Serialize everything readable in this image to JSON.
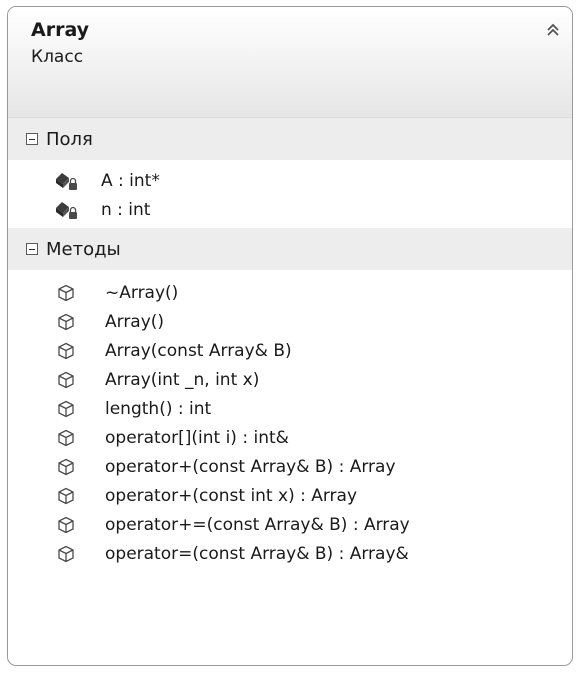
{
  "class": {
    "name": "Array",
    "kind": "Класс",
    "collapse_icon": "double-chevron-up-icon"
  },
  "fields_section": {
    "title": "Поля",
    "icon": "field-private-icon",
    "items": [
      "A : int*",
      "n : int"
    ]
  },
  "methods_section": {
    "title": "Методы",
    "icon": "method-icon",
    "items": [
      "~Array()",
      "Array()",
      "Array(const Array& B)",
      "Array(int _n, int x)",
      "length() : int",
      "operator[](int i) : int&",
      "operator+(const Array& B) : Array",
      "operator+(const int x) : Array",
      "operator+=(const Array& B) : Array",
      "operator=(const Array& B) : Array&"
    ]
  },
  "colors": {
    "border": "#9a9a9a",
    "section_bg": "#ededed",
    "text": "#1a1a1a"
  }
}
